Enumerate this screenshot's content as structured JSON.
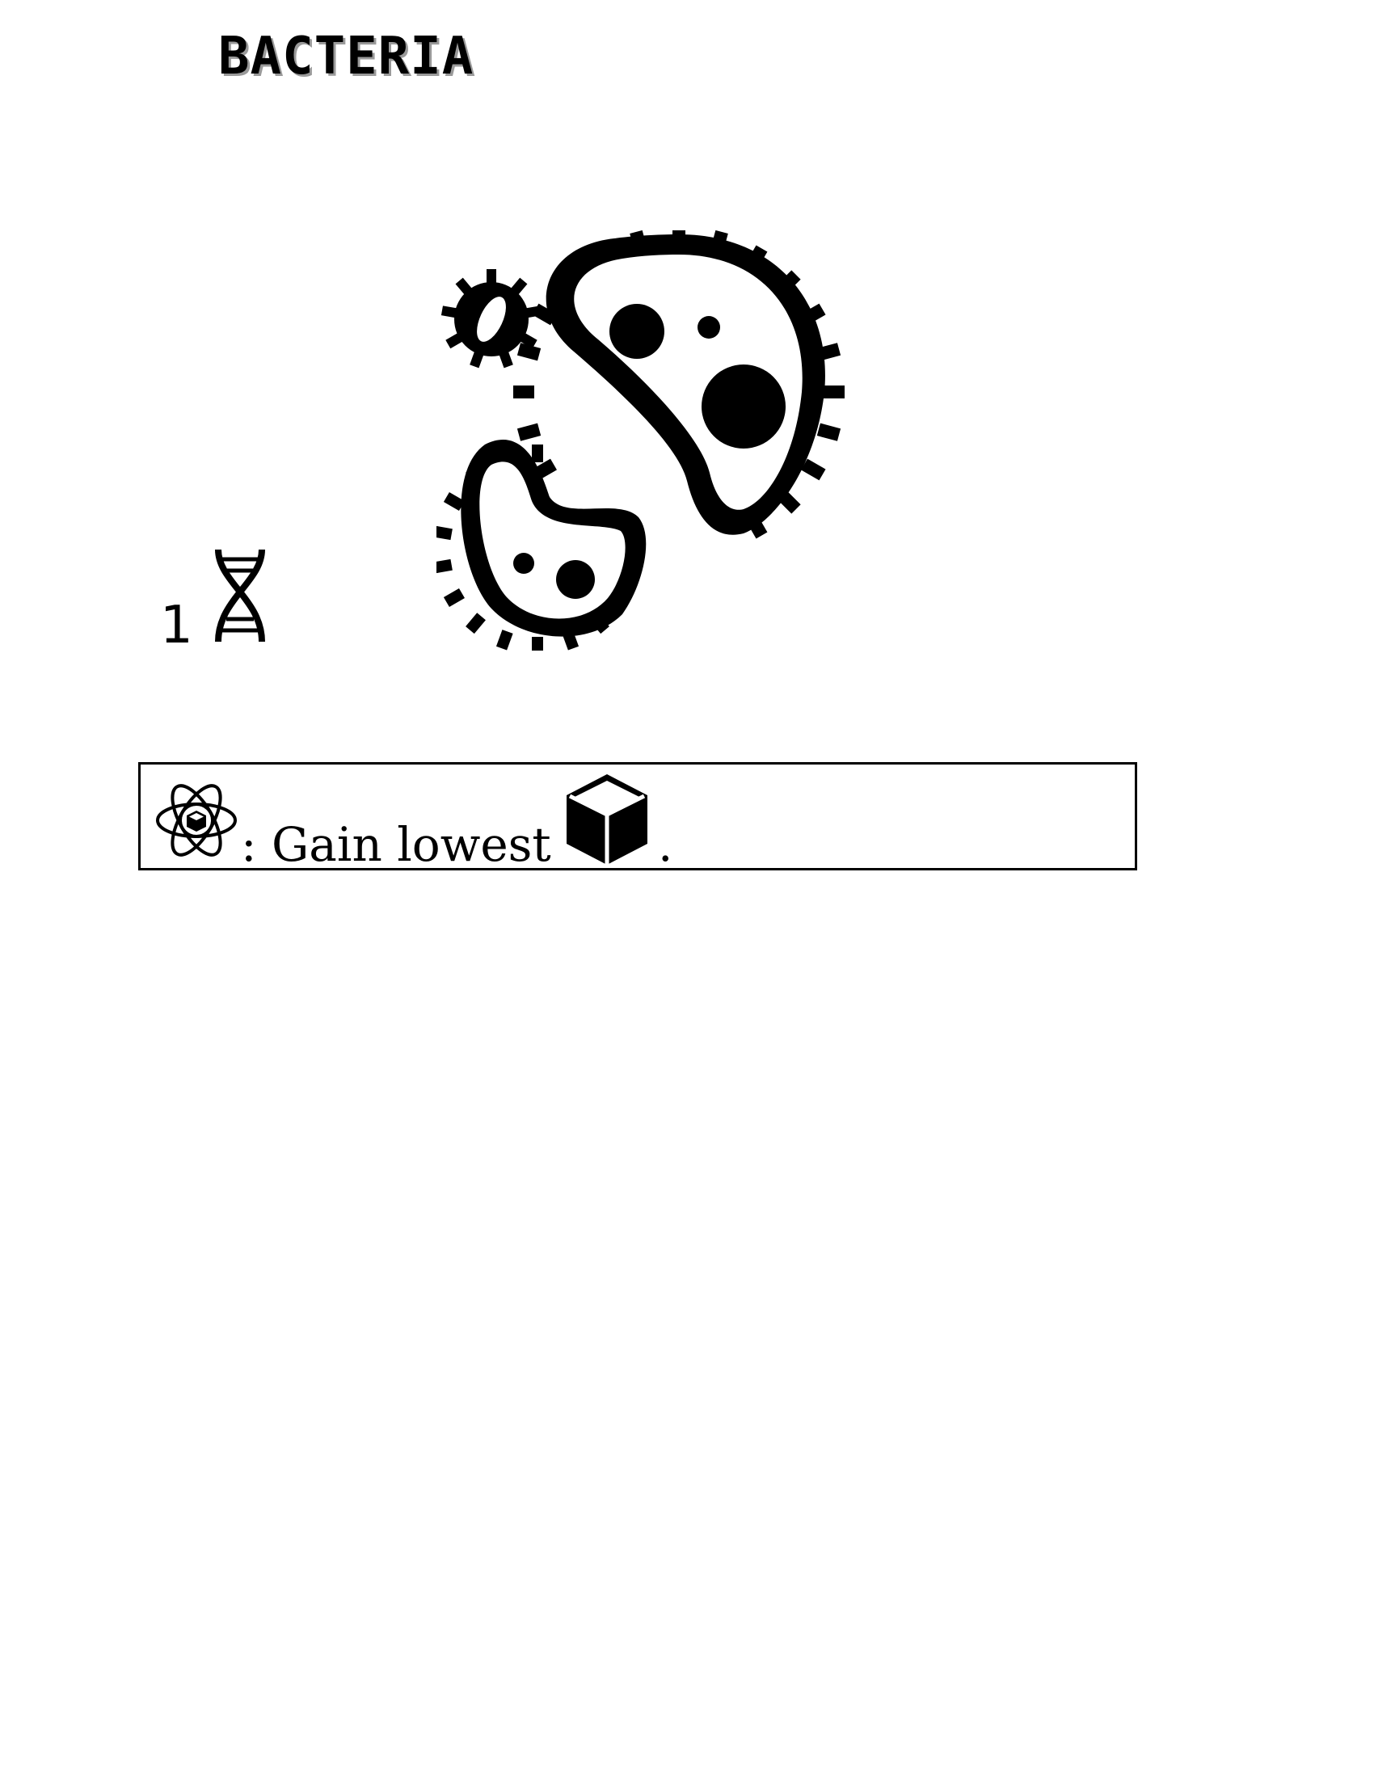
{
  "card": {
    "title": "BACTERIA",
    "art_icon": "bacteria-icon",
    "cost": {
      "value": "1",
      "icon": "dna-icon"
    },
    "ability": {
      "trigger_icon": "atom-cube-icon",
      "text": ": Gain lowest",
      "resource_icon": "cube-icon",
      "end": "."
    }
  }
}
